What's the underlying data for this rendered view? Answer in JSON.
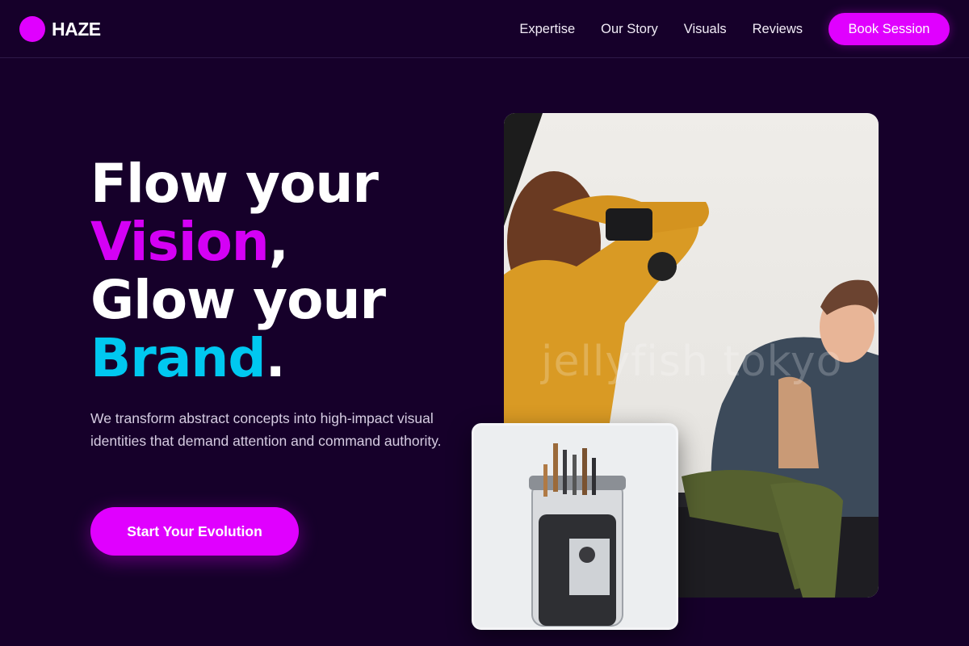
{
  "brand": {
    "name": "HAZE",
    "accent": "#e000ff",
    "secondary": "#00c8f0",
    "background": "#16002a"
  },
  "nav": {
    "links": [
      "Expertise",
      "Our Story",
      "Visuals",
      "Reviews"
    ],
    "cta_label": "Book Session"
  },
  "hero": {
    "line1": "Flow your",
    "line2_accent": "Vision",
    "line2_punct": ",",
    "line3": "Glow your",
    "line4_accent": "Brand",
    "line4_punct": ".",
    "description": "We transform abstract concepts into high-impact visual identities that demand attention and command authority.",
    "cta_label": "Start Your Evolution"
  },
  "images": {
    "main_watermark": "jellyfish tokyo",
    "main_icon": "photo-shoot-image",
    "secondary_icon": "brush-jar-image"
  }
}
